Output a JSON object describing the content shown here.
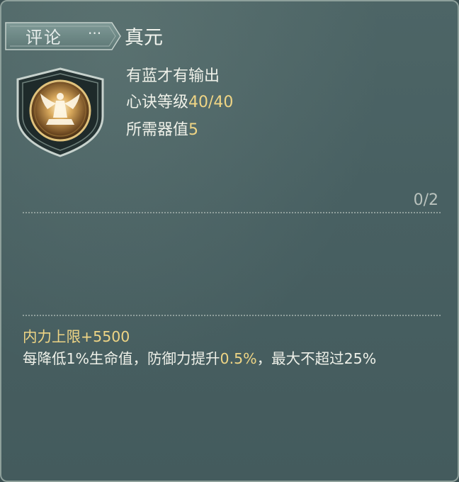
{
  "tag": {
    "label": "评论",
    "dots": "···"
  },
  "skill": {
    "name": "真元",
    "desc": "有蓝才有输出",
    "level_label": "心诀等级",
    "level_value": "40/40",
    "req_label": "所需器值",
    "req_value": "5"
  },
  "counter": "0/2",
  "effects": {
    "line1": "内力上限+5500",
    "line2_a": "每降低1%生命值，防御力提升",
    "line2_b": "0.5%",
    "line2_c": "，最大不超过25%"
  },
  "colors": {
    "accent": "#efd585",
    "text": "#eef0e8",
    "panel": "#4a6163"
  },
  "icons": {
    "emblem": "meditating-figure-emblem-icon"
  }
}
